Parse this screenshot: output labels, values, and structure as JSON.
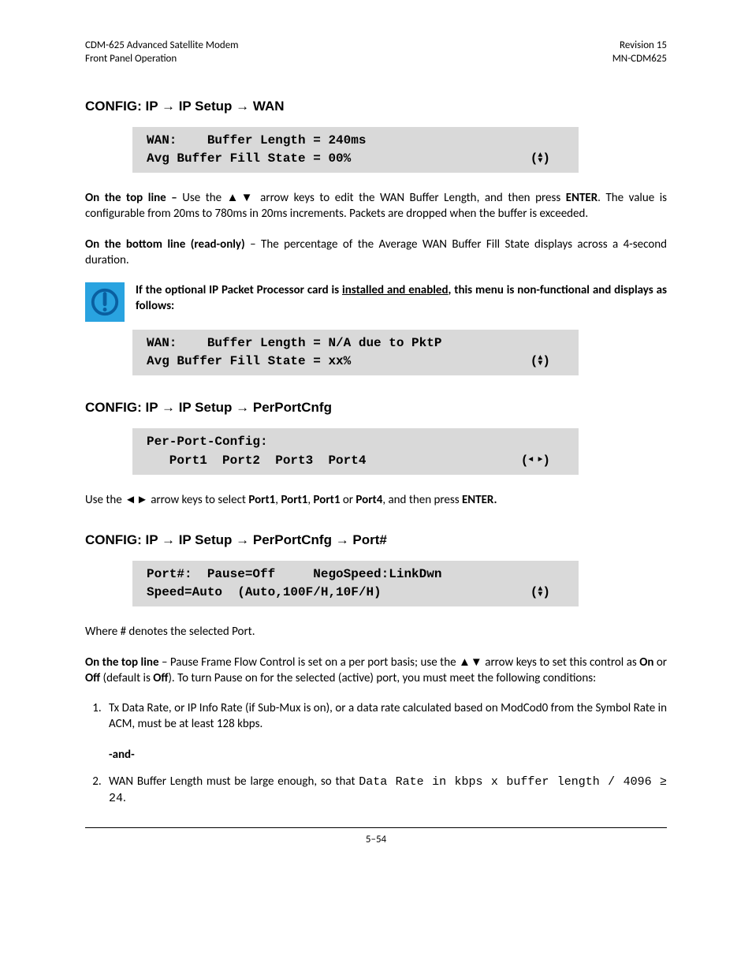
{
  "header": {
    "left1": "CDM-625 Advanced Satellite Modem",
    "left2": "Front Panel Operation",
    "right1": "Revision 15",
    "right2": "MN-CDM625"
  },
  "sec1": {
    "title_prefix": "CONFIG: IP ",
    "title_mid": " IP Setup ",
    "title_suffix": " WAN",
    "lcd1": "WAN:    Buffer Length = 240ms",
    "lcd2": "Avg Buffer Fill State = 00%",
    "p1a": "On the top line – ",
    "p1b": "Use the ▲▼ arrow keys to edit the WAN Buffer Length, and then press ",
    "p1c": "ENTER",
    "p1d": ". The value is configurable from 20ms to 780ms in 20ms increments. Packets are dropped when the buffer is exceeded.",
    "p2a": "On the bottom line (read-only)",
    "p2b": " – The percentage of the Average WAN Buffer Fill State displays across a 4-second duration.",
    "note1": "If the optional IP Packet Processor card is ",
    "note_u": "installed and enabled",
    "note2": ", this menu is non-functional and displays as follows:",
    "lcd3": "WAN:    Buffer Length = N/A due to PktP",
    "lcd4": "Avg Buffer Fill State = xx%"
  },
  "sec2": {
    "title_prefix": "CONFIG: IP ",
    "title_mid": " IP Setup ",
    "title_suffix": " PerPortCnfg",
    "lcd1": "Per-Port-Config:",
    "lcd2": "   Port1  Port2  Port3  Port4",
    "p1a": "Use the ◄► arrow keys to select ",
    "p1b": "Port1",
    "p1c": ", ",
    "p1d": "Port1",
    "p1e": ", ",
    "p1f": "Port1",
    "p1g": " or ",
    "p1h": "Port4",
    "p1i": ", and then press ",
    "p1j": "ENTER."
  },
  "sec3": {
    "title_prefix": "CONFIG: IP ",
    "title_mid1": " IP Setup ",
    "title_mid2": " PerPortCnfg ",
    "title_suffix": " Port#",
    "lcd1": "Port#:  Pause=Off     NegoSpeed:LinkDwn",
    "lcd2": "Speed=Auto  (Auto,100F/H,10F/H)",
    "p1": "Where # denotes the selected Port.",
    "p2a": "On the top line",
    "p2b": " – Pause Frame Flow Control is set on a per port basis; use the ▲▼ arrow keys to set this control as ",
    "p2c": "On",
    "p2d": " or ",
    "p2e": "Off",
    "p2f": " (default is ",
    "p2g": "Off",
    "p2h": "). To turn Pause on for the selected (active) port, you must meet the following conditions:",
    "li1": "Tx Data Rate, or IP Info Rate (if Sub-Mux is on), or a data rate calculated based on ModCod0 from the Symbol Rate in ACM, must be at least 128 kbps.",
    "and": "-and-",
    "li2a": "WAN Buffer Length must be large enough, so that ",
    "li2b": "Data Rate in kbps  x buffer length / 4096 ≥ 24",
    "li2c": "."
  },
  "footer": {
    "page": "5–54"
  },
  "glyph": {
    "rarrow": "→"
  }
}
